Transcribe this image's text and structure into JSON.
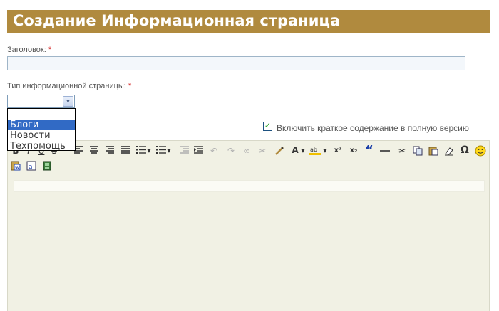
{
  "page": {
    "title": "Создание Информационная страница"
  },
  "form": {
    "title_label": "Заголовок:",
    "required_mark": "*",
    "title_value": "",
    "type_label": "Тип информационной страницы:",
    "type_selected": "",
    "type_options": [
      "Блоги",
      "Новости",
      "Техпомощь"
    ],
    "teaser_checkbox_label": "Включить краткое содержание в полную версию",
    "teaser_checked": true
  },
  "editor": {
    "toolbar_row1": [
      "bold-icon",
      "italic-icon",
      "underline-icon",
      "strikethrough-icon",
      "align-left-icon",
      "align-center-icon",
      "align-right-icon",
      "align-justify-icon",
      "bulleted-list-icon",
      "numbered-list-icon",
      "outdent-icon",
      "indent-icon",
      "undo-icon",
      "redo-icon",
      "link-icon",
      "unlink-icon",
      "cleanup-icon",
      "text-color-icon",
      "highlight-color-icon",
      "superscript-icon",
      "subscript-icon",
      "blockquote-icon",
      "horizontal-rule-icon",
      "cut-icon",
      "copy-icon",
      "paste-icon",
      "remove-format-icon",
      "special-char-icon",
      "emoticon-icon"
    ],
    "toolbar_row2": [
      "paste-word-icon",
      "paste-text-icon",
      "media-icon"
    ]
  },
  "glyphs": {
    "select_arrow": "▼",
    "check": "✓",
    "text_color": "A",
    "superscript": "x²",
    "subscript": "x₂",
    "blockquote": "“",
    "special_char": "Ω",
    "emoticon": "☺"
  },
  "colors": {
    "title_bar": "#b08a3e",
    "editor_bg": "#f1f1e4",
    "selected_option": "#316ac5",
    "required": "#cc0000"
  }
}
